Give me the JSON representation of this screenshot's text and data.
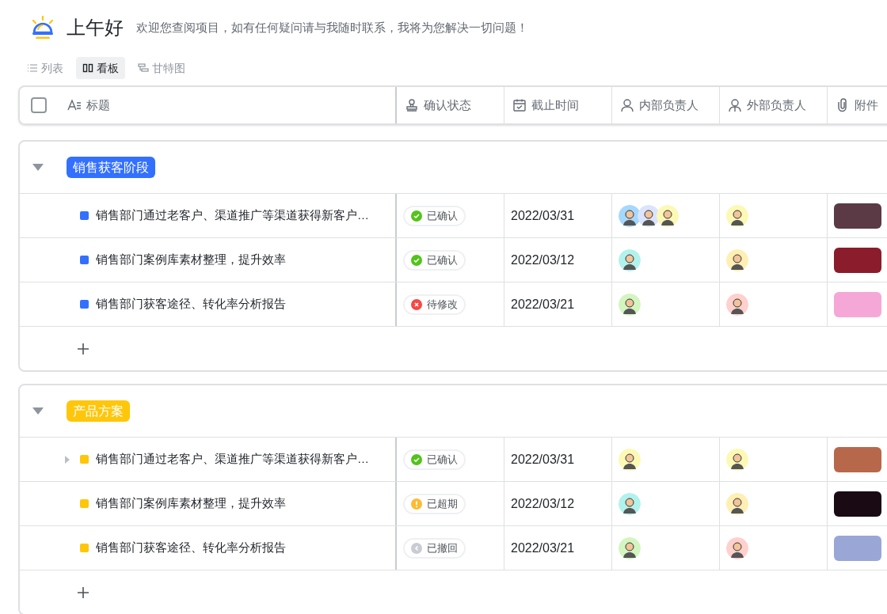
{
  "greeting": {
    "title": "上午好",
    "subtitle": "欢迎您查阅项目，如有任何疑问请与我随时联系，我将为您解决一切问题！"
  },
  "views": [
    {
      "label": "列表",
      "kind": "list",
      "selected": false
    },
    {
      "label": "看板",
      "kind": "board",
      "selected": true
    },
    {
      "label": "甘特图",
      "kind": "gantt",
      "selected": false
    }
  ],
  "table": {
    "select_all": {
      "checked": false
    },
    "columns": [
      {
        "label": "标题",
        "kind": "title"
      },
      {
        "label": "确认状态",
        "kind": "status"
      },
      {
        "label": "截止时间",
        "kind": "date"
      },
      {
        "label": "内部负责人",
        "kind": "person"
      },
      {
        "label": "外部负责人",
        "kind": "person-outline"
      },
      {
        "label": "附件",
        "kind": "attachment"
      }
    ],
    "groups": [
      {
        "name": "销售获客阶段",
        "color": "#3370ff",
        "expanded": true,
        "rows": [
          {
            "title": "销售部门通过老客户、渠道推广等渠道获得新客户…",
            "has_subtasks": false,
            "status": {
              "label": "已确认",
              "kind": "confirmed"
            },
            "due": "2022/03/31",
            "internal": [
              {
                "color": "#a5d8ff"
              },
              {
                "color": "#dbe4ff"
              },
              {
                "color": "#fcf9b5"
              }
            ],
            "external": [
              {
                "color": "#fcf9b5"
              }
            ],
            "attachment": {
              "color": "#5b3a45"
            }
          },
          {
            "title": "销售部门案例库素材整理，提升效率",
            "has_subtasks": false,
            "status": {
              "label": "已确认",
              "kind": "confirmed"
            },
            "due": "2022/03/12",
            "internal": [
              {
                "color": "#b2f2ec"
              }
            ],
            "external": [
              {
                "color": "#ffefb3"
              }
            ],
            "attachment": {
              "color": "#8a1c2c"
            }
          },
          {
            "title": "销售部门获客途径、转化率分析报告",
            "has_subtasks": false,
            "status": {
              "label": "待修改",
              "kind": "rejected"
            },
            "due": "2022/03/21",
            "internal": [
              {
                "color": "#d3f5c0"
              }
            ],
            "external": [
              {
                "color": "#ffd0cc"
              }
            ],
            "attachment": {
              "color": "#f5a8d8"
            }
          }
        ]
      },
      {
        "name": "产品方案",
        "color": "#ffc60a",
        "expanded": true,
        "rows": [
          {
            "title": "销售部门通过老客户、渠道推广等渠道获得新客户…",
            "has_subtasks": true,
            "status": {
              "label": "已确认",
              "kind": "confirmed"
            },
            "due": "2022/03/31",
            "internal": [
              {
                "color": "#fcf9b5"
              }
            ],
            "external": [
              {
                "color": "#fcf9b5"
              }
            ],
            "attachment": {
              "color": "#b8684a"
            }
          },
          {
            "title": "销售部门案例库素材整理，提升效率",
            "has_subtasks": false,
            "status": {
              "label": "已超期",
              "kind": "overdue"
            },
            "due": "2022/03/12",
            "internal": [
              {
                "color": "#b2f2ec"
              }
            ],
            "external": [
              {
                "color": "#ffefb3"
              }
            ],
            "attachment": {
              "color": "#1a0a14"
            }
          },
          {
            "title": "销售部门获客途径、转化率分析报告",
            "has_subtasks": false,
            "status": {
              "label": "已撤回",
              "kind": "withdrawn"
            },
            "due": "2022/03/21",
            "internal": [
              {
                "color": "#d3f5c0"
              }
            ],
            "external": [
              {
                "color": "#ffd0cc"
              }
            ],
            "attachment": {
              "color": "#9aa6d6"
            }
          }
        ]
      }
    ]
  }
}
